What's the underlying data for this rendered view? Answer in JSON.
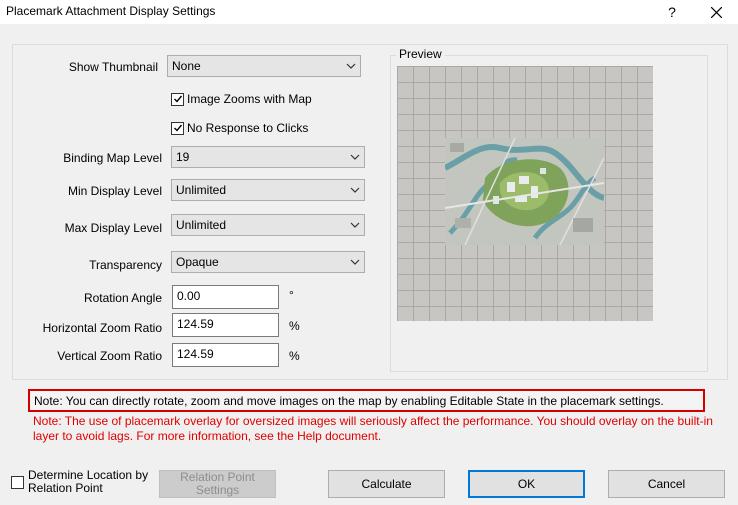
{
  "window": {
    "title": "Placemark Attachment Display Settings",
    "help_glyph": "?"
  },
  "settings": {
    "show_thumbnail": {
      "label": "Show Thumbnail",
      "value": "None"
    },
    "image_zooms_with_map": {
      "label": "Image Zooms with Map",
      "checked": true
    },
    "no_response_to_clicks": {
      "label": "No Response to Clicks",
      "checked": true
    },
    "binding_map_level": {
      "label": "Binding Map Level",
      "value": "19"
    },
    "min_display_level": {
      "label": "Min Display Level",
      "value": "Unlimited"
    },
    "max_display_level": {
      "label": "Max Display Level",
      "value": "Unlimited"
    },
    "transparency": {
      "label": "Transparency",
      "value": "Opaque"
    },
    "rotation_angle": {
      "label": "Rotation Angle",
      "value": "0.00",
      "unit": "°"
    },
    "horizontal_zoom_ratio": {
      "label": "Horizontal Zoom Ratio",
      "value": "124.59",
      "unit": "%"
    },
    "vertical_zoom_ratio": {
      "label": "Vertical Zoom Ratio",
      "value": "124.59",
      "unit": "%"
    }
  },
  "preview": {
    "label": "Preview"
  },
  "notes": {
    "boxed": "Note: You can directly rotate, zoom and move images on the map by enabling Editable State in the placemark settings.",
    "warning": "Note: The use of placemark overlay for oversized images will seriously affect the performance. You should overlay on the built-in layer to avoid lags. For more information, see the Help document."
  },
  "footer": {
    "determine_location": {
      "label": "Determine Location by Relation Point",
      "checked": false
    },
    "relation_point_settings": "Relation Point Settings",
    "calculate": "Calculate",
    "ok": "OK",
    "cancel": "Cancel"
  },
  "colors": {
    "note_red": "#e00000",
    "accent": "#0078d7"
  }
}
